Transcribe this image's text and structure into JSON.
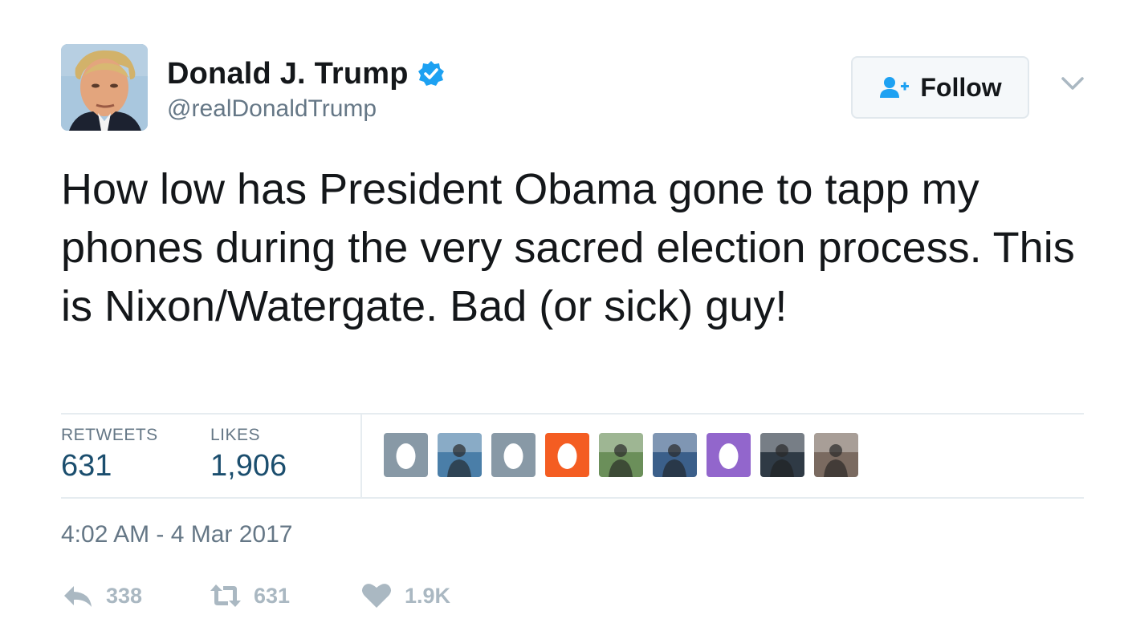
{
  "user": {
    "name": "Donald J. Trump",
    "handle": "@realDonaldTrump",
    "verified": true
  },
  "follow_button": {
    "label": "Follow"
  },
  "tweet": {
    "text": "How low has President Obama gone to tapp my phones during the very sacred election process. This is Nixon/Watergate. Bad (or sick) guy!",
    "timestamp": "4:02 AM - 4 Mar 2017"
  },
  "stats": {
    "retweets_label": "RETWEETS",
    "retweets_value": "631",
    "likes_label": "LIKES",
    "likes_value": "1,906"
  },
  "likers": [
    {
      "icon": "egg-avatar",
      "color": "#8899a6"
    },
    {
      "icon": "photo-avatar",
      "color": "#4a7ea8"
    },
    {
      "icon": "egg-avatar",
      "color": "#8899a6"
    },
    {
      "icon": "egg-avatar",
      "color": "#f45d22"
    },
    {
      "icon": "photo-avatar",
      "color": "#6b8f5a"
    },
    {
      "icon": "photo-avatar",
      "color": "#3b5f8a"
    },
    {
      "icon": "egg-avatar",
      "color": "#9266cc"
    },
    {
      "icon": "photo-avatar",
      "color": "#2f3a45"
    },
    {
      "icon": "photo-avatar",
      "color": "#7a6a60"
    }
  ],
  "actions": {
    "reply_count": "338",
    "retweet_count": "631",
    "like_count": "1.9K"
  },
  "colors": {
    "accent": "#1da1f2",
    "stat_value": "#1b4e6e",
    "muted": "#657786",
    "action_muted": "#aab8c2"
  }
}
